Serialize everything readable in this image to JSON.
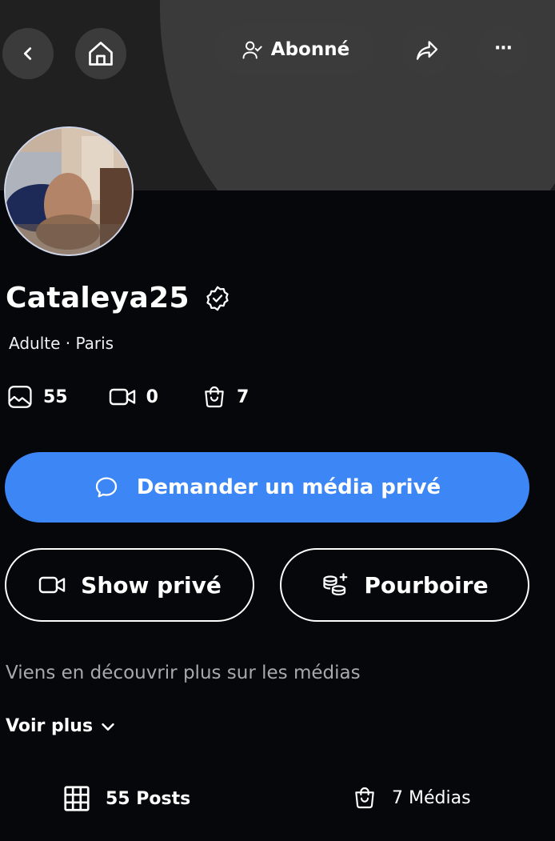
{
  "header": {
    "back_icon": "chevron-left-icon",
    "home_icon": "home-icon",
    "subscribe_label": "Abonné",
    "subscribe_icon": "user-check-icon",
    "share_icon": "share-icon",
    "more_label": "···"
  },
  "profile": {
    "name": "Cataleya25",
    "verified_icon": "verified-badge-icon",
    "meta": "Adulte · Paris",
    "stats": [
      {
        "icon": "photo-icon",
        "value": "55"
      },
      {
        "icon": "video-icon",
        "value": "0"
      },
      {
        "icon": "shopping-bag-icon",
        "value": "7"
      }
    ]
  },
  "actions": {
    "request_label": "Demander un média privé",
    "show_label": "Show privé",
    "tip_label": "Pourboire"
  },
  "bio": {
    "text": "Viens en découvrir plus sur les médias",
    "more_label": "Voir plus"
  },
  "tabs": {
    "posts_label": "55 Posts",
    "media_label": "7 Médias"
  },
  "colors": {
    "background": "#05070b",
    "accent": "#3d86f6",
    "button_bg": "#3b3b3b"
  }
}
